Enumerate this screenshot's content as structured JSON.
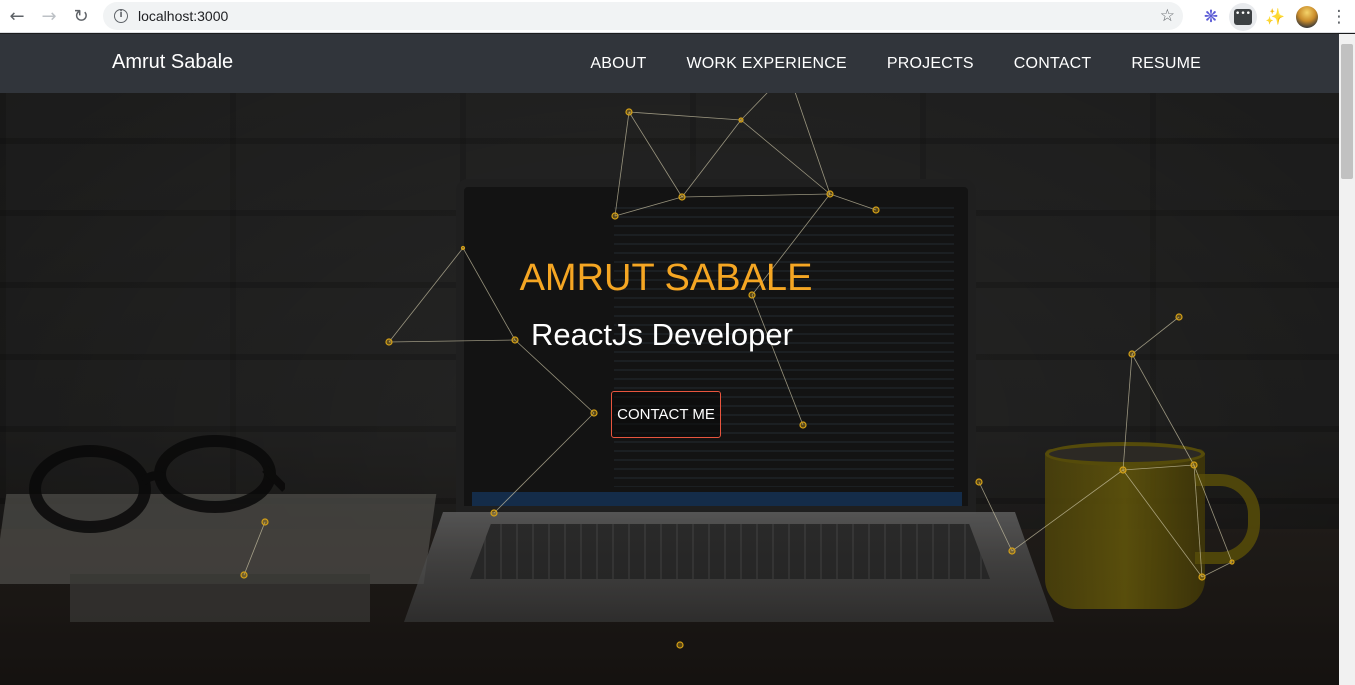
{
  "browser": {
    "url": "localhost:3000",
    "back_icon": "back-arrow-icon",
    "forward_icon": "forward-arrow-icon",
    "reload_icon": "reload-icon"
  },
  "site": {
    "brand": "Amrut Sabale",
    "nav": [
      {
        "label": "ABOUT"
      },
      {
        "label": "WORK EXPERIENCE"
      },
      {
        "label": "PROJECTS"
      },
      {
        "label": "CONTACT"
      },
      {
        "label": "RESUME"
      }
    ]
  },
  "hero": {
    "name": "AMRUT SABALE",
    "role": "ReactJs Developer",
    "cta": "CONTACT ME"
  },
  "colors": {
    "accent": "#f5a623",
    "header_bg": "#31353b",
    "button_border": "#e8553e",
    "particle": "#d4a017"
  }
}
